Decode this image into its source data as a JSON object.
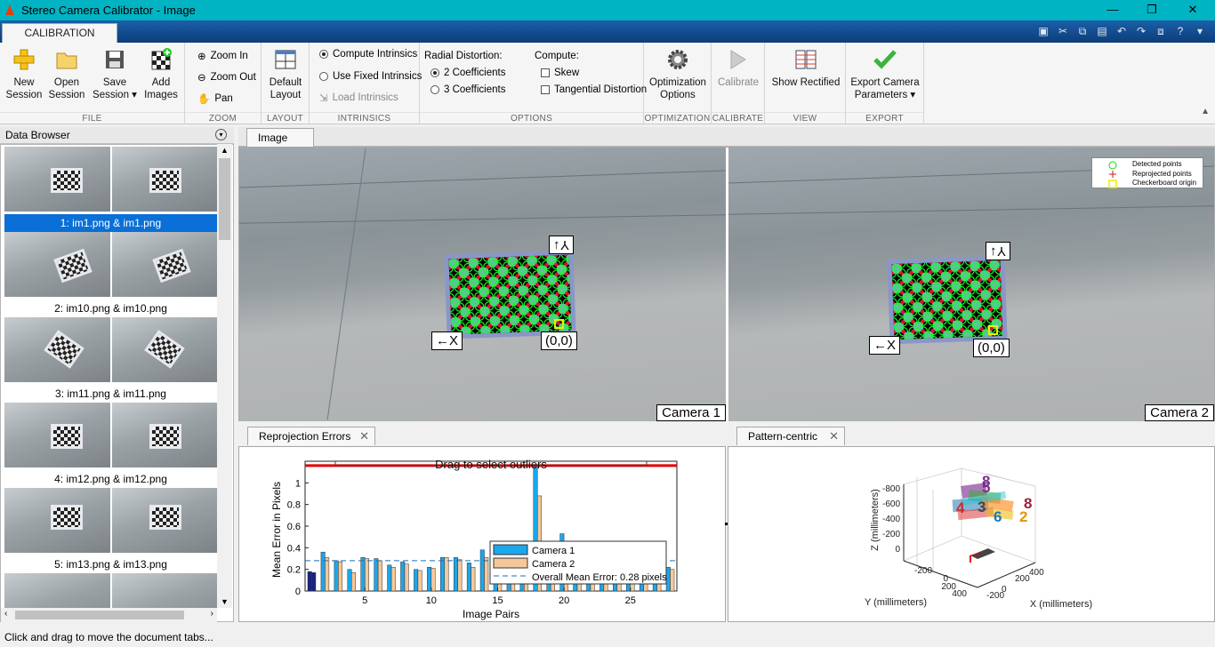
{
  "window": {
    "title": "Stereo Camera Calibrator - Image",
    "minimize": "—",
    "restore": "❐",
    "close": "✕"
  },
  "ribbon_tab": "CALIBRATION",
  "groups": {
    "file": {
      "label": "FILE",
      "new_session": "New Session",
      "open_session": "Open Session",
      "save_session": "Save Session",
      "add_images": "Add Images"
    },
    "zoom": {
      "label": "ZOOM",
      "zoom_in": "Zoom In",
      "zoom_out": "Zoom Out",
      "pan": "Pan"
    },
    "layout": {
      "label": "LAYOUT",
      "default_layout": "Default Layout"
    },
    "intrinsics": {
      "label": "INTRINSICS",
      "compute": "Compute Intrinsics",
      "fixed": "Use Fixed Intrinsics",
      "load": "Load Intrinsics"
    },
    "options": {
      "label": "OPTIONS",
      "radial_heading": "Radial Distortion:",
      "coef2": "2 Coefficients",
      "coef3": "3 Coefficients",
      "compute_heading": "Compute:",
      "skew": "Skew",
      "tangential": "Tangential Distortion"
    },
    "optimization": {
      "label": "OPTIMIZATION",
      "options": "Optimization Options"
    },
    "calibrate": {
      "label": "CALIBRATE",
      "calibrate": "Calibrate"
    },
    "view": {
      "label": "VIEW",
      "show_rectified": "Show Rectified"
    },
    "export": {
      "label": "EXPORT",
      "export_params": "Export Camera Parameters"
    }
  },
  "data_browser": {
    "title": "Data Browser",
    "items": [
      {
        "label": "1: im1.png & im1.png",
        "selected": true
      },
      {
        "label": "2: im10.png & im10.png",
        "selected": false
      },
      {
        "label": "3: im11.png & im11.png",
        "selected": false
      },
      {
        "label": "4: im12.png & im12.png",
        "selected": false
      },
      {
        "label": "5: im13.png & im13.png",
        "selected": false
      }
    ]
  },
  "image_panel": {
    "tab": "Image",
    "camera1": "Camera 1",
    "camera2": "Camera 2",
    "origin_label": "(0,0)",
    "x_label": "X",
    "y_label": "Y",
    "legend": {
      "detected": "Detected points",
      "reprojected": "Reprojected points",
      "origin": "Checkerboard origin"
    }
  },
  "reprojection": {
    "tab": "Reprojection Errors",
    "drag_text": "Drag to select outliers",
    "legend_cam1": "Camera 1",
    "legend_cam2": "Camera 2",
    "legend_mean": "Overall Mean Error: 0.28 pixels"
  },
  "pattern_centric": {
    "tab": "Pattern-centric",
    "z_label": "Z (millimeters)",
    "y_label": "Y (millimeters)",
    "x_label": "X (millimeters)",
    "z_ticks": [
      "-800",
      "-600",
      "-400",
      "-200",
      "0"
    ],
    "y_ticks": [
      "-200",
      "0",
      "200",
      "400"
    ],
    "x_ticks": [
      "-200",
      "0",
      "200",
      "400"
    ],
    "digits": [
      "8",
      "5",
      "4",
      "8",
      "2",
      "3",
      "6"
    ]
  },
  "chart_data": {
    "type": "bar",
    "title": "",
    "xlabel": "Image Pairs",
    "ylabel": "Mean Error in Pixels",
    "xlim": [
      0.5,
      28.5
    ],
    "ylim": [
      0,
      1.2
    ],
    "xticks": [
      5,
      10,
      15,
      20,
      25
    ],
    "yticks": [
      0,
      0.2,
      0.4,
      0.6,
      0.8,
      1
    ],
    "categories": [
      1,
      2,
      3,
      4,
      5,
      6,
      7,
      8,
      9,
      10,
      11,
      12,
      13,
      14,
      15,
      16,
      17,
      18,
      19,
      20,
      21,
      22,
      23,
      24,
      25,
      26,
      27,
      28
    ],
    "series": [
      {
        "name": "Camera 1",
        "values": [
          0.18,
          0.36,
          0.28,
          0.2,
          0.31,
          0.3,
          0.24,
          0.27,
          0.2,
          0.22,
          0.31,
          0.31,
          0.26,
          0.38,
          0.45,
          0.3,
          0.3,
          1.15,
          0.2,
          0.53,
          0.28,
          0.2,
          0.3,
          0.22,
          0.26,
          0.3,
          0.24,
          0.22
        ]
      },
      {
        "name": "Camera 2",
        "values": [
          0.17,
          0.31,
          0.27,
          0.17,
          0.3,
          0.28,
          0.22,
          0.25,
          0.19,
          0.21,
          0.31,
          0.29,
          0.22,
          0.31,
          0.41,
          0.28,
          0.28,
          0.88,
          0.18,
          0.4,
          0.24,
          0.18,
          0.28,
          0.2,
          0.24,
          0.27,
          0.22,
          0.2
        ]
      }
    ],
    "overall_mean": 0.28,
    "threshold_line": 1.16,
    "colors": {
      "camera1": "#1aa7ec",
      "camera2": "#f5c89a",
      "selected": "#1a237e",
      "threshold": "#e00000",
      "mean": "#1a6fb5"
    }
  },
  "status": "Click and drag to move the document tabs..."
}
